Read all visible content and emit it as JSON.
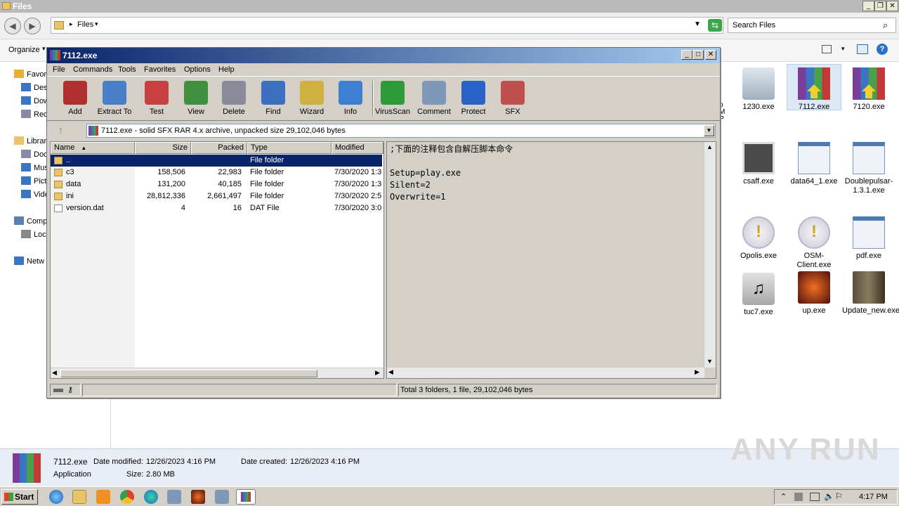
{
  "explorer": {
    "title": "Files",
    "address_crumb": "Files",
    "search_placeholder": "Search Files",
    "toolbar": {
      "organize": "Organize"
    },
    "nav": [
      {
        "label": "Favori",
        "icon": "star-icon"
      },
      {
        "label": "Des",
        "icon": "desktop-icon"
      },
      {
        "label": "Dow",
        "icon": "downloads-icon"
      },
      {
        "label": "Rec",
        "icon": "recent-icon"
      },
      {
        "label": "Librar",
        "icon": "library-icon"
      },
      {
        "label": "Doc",
        "icon": "documents-icon"
      },
      {
        "label": "Mus",
        "icon": "music-icon"
      },
      {
        "label": "Pict",
        "icon": "pictures-icon"
      },
      {
        "label": "Vide",
        "icon": "video-icon"
      },
      {
        "label": "Comp",
        "icon": "computer-icon"
      },
      {
        "label": "Loc",
        "icon": "drive-icon"
      },
      {
        "label": "Netw",
        "icon": "network-icon"
      }
    ],
    "side_trunc": [
      "p",
      "M",
      "P",
      "."
    ],
    "files": [
      {
        "label": "1230.exe"
      },
      {
        "label": "7112.exe"
      },
      {
        "label": "7120.exe"
      },
      {
        "label": "csaff.exe"
      },
      {
        "label": "data64_1.exe"
      },
      {
        "label": "Doublepulsar-1.3.1.exe"
      },
      {
        "label": "Opolis.exe"
      },
      {
        "label": "OSM-Client.exe"
      },
      {
        "label": "pdf.exe"
      },
      {
        "label": "tuc7.exe"
      },
      {
        "label": "up.exe"
      },
      {
        "label": "Update_new.exe"
      }
    ],
    "details": {
      "name": "7112.exe",
      "modified_label": "Date modified:",
      "modified": "12/26/2023 4:16 PM",
      "created_label": "Date created:",
      "created": "12/26/2023 4:16 PM",
      "type": "Application",
      "size_label": "Size:",
      "size": "2.80 MB"
    }
  },
  "winrar": {
    "title": "7112.exe",
    "menu": [
      "File",
      "Commands",
      "Tools",
      "Favorites",
      "Options",
      "Help"
    ],
    "tools": [
      {
        "label": "Add",
        "color": "#b03030"
      },
      {
        "label": "Extract To",
        "color": "#4a7fc8"
      },
      {
        "label": "Test",
        "color": "#c84040"
      },
      {
        "label": "View",
        "color": "#3f8f3f"
      },
      {
        "label": "Delete",
        "color": "#8a8a9a"
      },
      {
        "label": "Find",
        "color": "#3d6fc0"
      },
      {
        "label": "Wizard",
        "color": "#d0b040"
      },
      {
        "label": "Info",
        "color": "#3d7fd0"
      },
      {
        "label": "VirusScan",
        "color": "#2f9a3a"
      },
      {
        "label": "Comment",
        "color": "#7f98b8"
      },
      {
        "label": "Protect",
        "color": "#2a63c8"
      },
      {
        "label": "SFX",
        "color": "#c05050"
      }
    ],
    "path": "7112.exe - solid SFX RAR 4.x archive, unpacked size 29,102,046 bytes",
    "columns": [
      "Name",
      "Size",
      "Packed",
      "Type",
      "Modified"
    ],
    "rows": [
      {
        "name": "..",
        "size": "",
        "packed": "",
        "type": "File folder",
        "modified": ""
      },
      {
        "name": "c3",
        "size": "158,506",
        "packed": "22,983",
        "type": "File folder",
        "modified": "7/30/2020 1:3"
      },
      {
        "name": "data",
        "size": "131,200",
        "packed": "40,185",
        "type": "File folder",
        "modified": "7/30/2020 1:3"
      },
      {
        "name": "ini",
        "size": "28,812,336",
        "packed": "2,661,497",
        "type": "File folder",
        "modified": "7/30/2020 2:5"
      },
      {
        "name": "version.dat",
        "size": "4",
        "packed": "16",
        "type": "DAT File",
        "modified": "7/30/2020 3:0"
      }
    ],
    "comment_lines": [
      ";下面的注释包含自解压脚本命令",
      "",
      "Setup=play.exe",
      "Silent=2",
      "Overwrite=1"
    ],
    "status": "Total 3 folders, 1 file, 29,102,046 bytes"
  },
  "taskbar": {
    "start": "Start",
    "time": "4:17 PM",
    "watermark": "ANY RUN"
  }
}
